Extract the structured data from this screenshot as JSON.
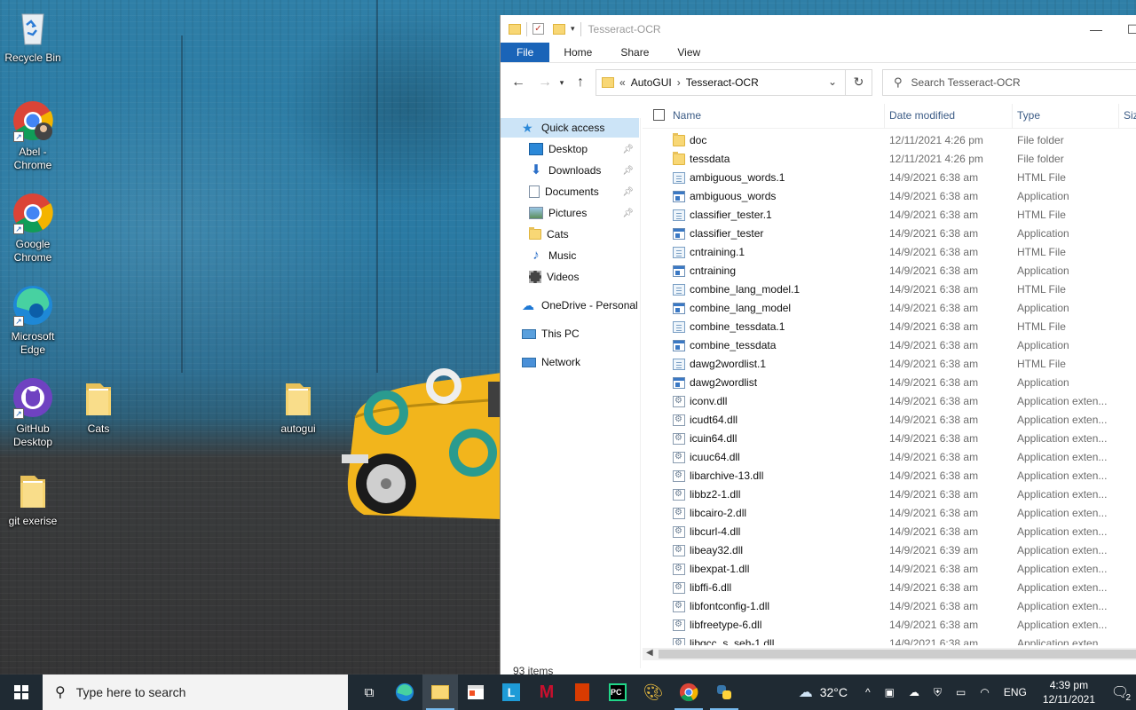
{
  "desktop": {
    "icons": [
      {
        "label": "Recycle Bin"
      },
      {
        "label": "Abel - Chrome"
      },
      {
        "label": "Google Chrome"
      },
      {
        "label": "Microsoft Edge"
      },
      {
        "label": "GitHub Desktop"
      },
      {
        "label": "Cats"
      },
      {
        "label": "autogui"
      },
      {
        "label": "git exerise"
      }
    ]
  },
  "explorer": {
    "title": "Tesseract-OCR",
    "ribbon_tabs": [
      "File",
      "Home",
      "Share",
      "View"
    ],
    "breadcrumb": [
      "AutoGUI",
      "Tesseract-OCR"
    ],
    "breadcrumb_overflow": "«",
    "search_placeholder": "Search Tesseract-OCR",
    "nav": {
      "quick_access": "Quick access",
      "items": [
        "Desktop",
        "Downloads",
        "Documents",
        "Pictures",
        "Cats",
        "Music",
        "Videos"
      ],
      "onedrive": "OneDrive - Personal",
      "thispc": "This PC",
      "network": "Network"
    },
    "columns": {
      "name": "Name",
      "date": "Date modified",
      "type": "Type",
      "size": "Siz"
    },
    "files": [
      {
        "name": "doc",
        "date": "12/11/2021 4:26 pm",
        "type": "File folder",
        "icon": "folder-icon"
      },
      {
        "name": "tessdata",
        "date": "12/11/2021 4:26 pm",
        "type": "File folder",
        "icon": "folder-icon"
      },
      {
        "name": "ambiguous_words.1",
        "date": "14/9/2021 6:38 am",
        "type": "HTML File",
        "icon": "html-file-icon"
      },
      {
        "name": "ambiguous_words",
        "date": "14/9/2021 6:38 am",
        "type": "Application",
        "icon": "application-icon"
      },
      {
        "name": "classifier_tester.1",
        "date": "14/9/2021 6:38 am",
        "type": "HTML File",
        "icon": "html-file-icon"
      },
      {
        "name": "classifier_tester",
        "date": "14/9/2021 6:38 am",
        "type": "Application",
        "icon": "application-icon"
      },
      {
        "name": "cntraining.1",
        "date": "14/9/2021 6:38 am",
        "type": "HTML File",
        "icon": "html-file-icon"
      },
      {
        "name": "cntraining",
        "date": "14/9/2021 6:38 am",
        "type": "Application",
        "icon": "application-icon"
      },
      {
        "name": "combine_lang_model.1",
        "date": "14/9/2021 6:38 am",
        "type": "HTML File",
        "icon": "html-file-icon"
      },
      {
        "name": "combine_lang_model",
        "date": "14/9/2021 6:38 am",
        "type": "Application",
        "icon": "application-icon"
      },
      {
        "name": "combine_tessdata.1",
        "date": "14/9/2021 6:38 am",
        "type": "HTML File",
        "icon": "html-file-icon"
      },
      {
        "name": "combine_tessdata",
        "date": "14/9/2021 6:38 am",
        "type": "Application",
        "icon": "application-icon"
      },
      {
        "name": "dawg2wordlist.1",
        "date": "14/9/2021 6:38 am",
        "type": "HTML File",
        "icon": "html-file-icon"
      },
      {
        "name": "dawg2wordlist",
        "date": "14/9/2021 6:38 am",
        "type": "Application",
        "icon": "application-icon"
      },
      {
        "name": "iconv.dll",
        "date": "14/9/2021 6:38 am",
        "type": "Application exten...",
        "icon": "dll-file-icon"
      },
      {
        "name": "icudt64.dll",
        "date": "14/9/2021 6:38 am",
        "type": "Application exten...",
        "icon": "dll-file-icon"
      },
      {
        "name": "icuin64.dll",
        "date": "14/9/2021 6:38 am",
        "type": "Application exten...",
        "icon": "dll-file-icon"
      },
      {
        "name": "icuuc64.dll",
        "date": "14/9/2021 6:38 am",
        "type": "Application exten...",
        "icon": "dll-file-icon"
      },
      {
        "name": "libarchive-13.dll",
        "date": "14/9/2021 6:38 am",
        "type": "Application exten...",
        "icon": "dll-file-icon"
      },
      {
        "name": "libbz2-1.dll",
        "date": "14/9/2021 6:38 am",
        "type": "Application exten...",
        "icon": "dll-file-icon"
      },
      {
        "name": "libcairo-2.dll",
        "date": "14/9/2021 6:38 am",
        "type": "Application exten...",
        "icon": "dll-file-icon"
      },
      {
        "name": "libcurl-4.dll",
        "date": "14/9/2021 6:38 am",
        "type": "Application exten...",
        "icon": "dll-file-icon"
      },
      {
        "name": "libeay32.dll",
        "date": "14/9/2021 6:39 am",
        "type": "Application exten...",
        "icon": "dll-file-icon"
      },
      {
        "name": "libexpat-1.dll",
        "date": "14/9/2021 6:38 am",
        "type": "Application exten...",
        "icon": "dll-file-icon"
      },
      {
        "name": "libffi-6.dll",
        "date": "14/9/2021 6:38 am",
        "type": "Application exten...",
        "icon": "dll-file-icon"
      },
      {
        "name": "libfontconfig-1.dll",
        "date": "14/9/2021 6:38 am",
        "type": "Application exten...",
        "icon": "dll-file-icon"
      },
      {
        "name": "libfreetype-6.dll",
        "date": "14/9/2021 6:38 am",
        "type": "Application exten...",
        "icon": "dll-file-icon"
      },
      {
        "name": "libgcc_s_seh-1.dll",
        "date": "14/9/2021 6:38 am",
        "type": "Application exten...",
        "icon": "dll-file-icon"
      }
    ],
    "status": "93 items"
  },
  "taskbar": {
    "search_placeholder": "Type here to search",
    "apps": [
      "task-view-icon",
      "edge-icon",
      "file-explorer-icon",
      "store-icon",
      "l-app-icon",
      "mcafee-icon",
      "office-icon",
      "pycharm-icon",
      "paint-icon",
      "chrome-icon",
      "python-icon"
    ],
    "weather": "32°C",
    "language": "ENG",
    "time": "4:39 pm",
    "date": "12/11/2021",
    "notification_count": "2"
  },
  "colors": {
    "accent": "#1a64b8",
    "selected": "#cce4f7",
    "taskbar": "#1f2a33",
    "folder": "#f8d775"
  }
}
